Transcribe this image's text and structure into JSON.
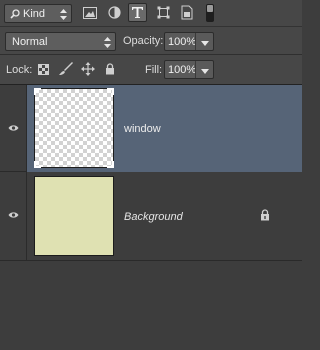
{
  "filter": {
    "kind_label": "Kind",
    "icons": [
      "image-filter-icon",
      "adjustment-filter-icon",
      "type-filter-icon",
      "shape-filter-icon",
      "smart-object-filter-icon",
      "filter-toggle-icon"
    ]
  },
  "blend": {
    "mode": "Normal",
    "opacity_label": "Opacity:",
    "opacity_value": "100%",
    "lock_label": "Lock:",
    "fill_label": "Fill:",
    "fill_value": "100%"
  },
  "layers": [
    {
      "name": "window",
      "visible": true,
      "selected": true,
      "thumbnail": "transparent",
      "locked": false
    },
    {
      "name": "Background",
      "visible": true,
      "selected": false,
      "thumbnail_color": "#dfe1b2",
      "locked": true
    }
  ],
  "colors": {
    "panel_bg": "#3d3d3d",
    "bar_bg": "#474747",
    "selection": "#566477",
    "background_swatch": "#dfe1b2"
  }
}
